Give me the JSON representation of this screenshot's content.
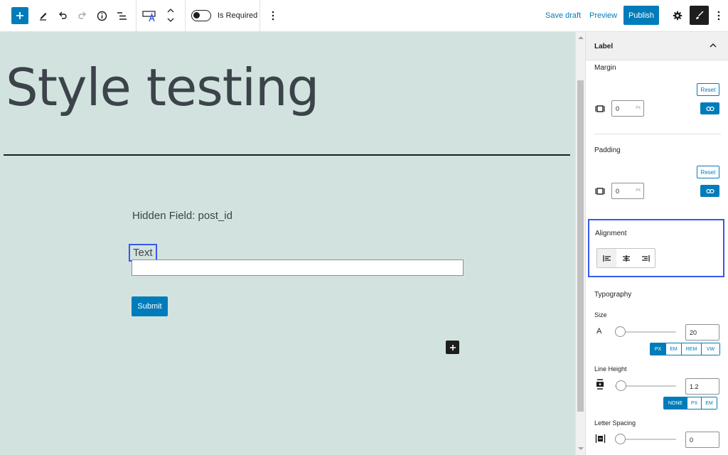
{
  "toolbar": {
    "toggle_label": "Is Required",
    "save_draft": "Save draft",
    "preview": "Preview",
    "publish": "Publish"
  },
  "canvas": {
    "title": "Style testing",
    "hidden_field": "Hidden Field: post_id",
    "text_label": "Text",
    "text_input_value": "",
    "submit": "Submit"
  },
  "sidebar": {
    "panel_title": "Label",
    "margin": {
      "title": "Margin",
      "reset": "Reset",
      "value": "0",
      "unit": "PX"
    },
    "padding": {
      "title": "Padding",
      "reset": "Reset",
      "value": "0",
      "unit": "PX"
    },
    "alignment": {
      "title": "Alignment",
      "selected": "left"
    },
    "typography": {
      "title": "Typography",
      "size_label": "Size",
      "size_icon": "A",
      "size_value": "20",
      "size_units": [
        "PX",
        "EM",
        "REM",
        "VW"
      ],
      "size_unit_selected": "PX",
      "line_height_label": "Line Height",
      "line_height_value": "1.2",
      "line_height_units": [
        "NONE",
        "PX",
        "EM"
      ],
      "line_height_unit_selected": "NONE",
      "letter_spacing_label": "Letter Spacing",
      "letter_spacing_value": "0"
    }
  },
  "colors": {
    "accent": "#007cba",
    "canvas_bg": "#d2e3df",
    "highlight": "#3858e9",
    "dark": "#1e1e1e"
  },
  "icons": [
    "plus-icon",
    "pencil-icon",
    "undo-icon",
    "redo-icon",
    "info-icon",
    "list-view-icon",
    "text-field-block-icon",
    "chevron-up-icon",
    "chevron-down-icon",
    "more-vertical-icon",
    "gear-icon",
    "brush-icon",
    "chevron-up-icon",
    "margin-box-icon",
    "link-icon",
    "align-left-icon",
    "align-center-icon",
    "align-right-icon",
    "line-height-icon",
    "letter-spacing-icon"
  ]
}
